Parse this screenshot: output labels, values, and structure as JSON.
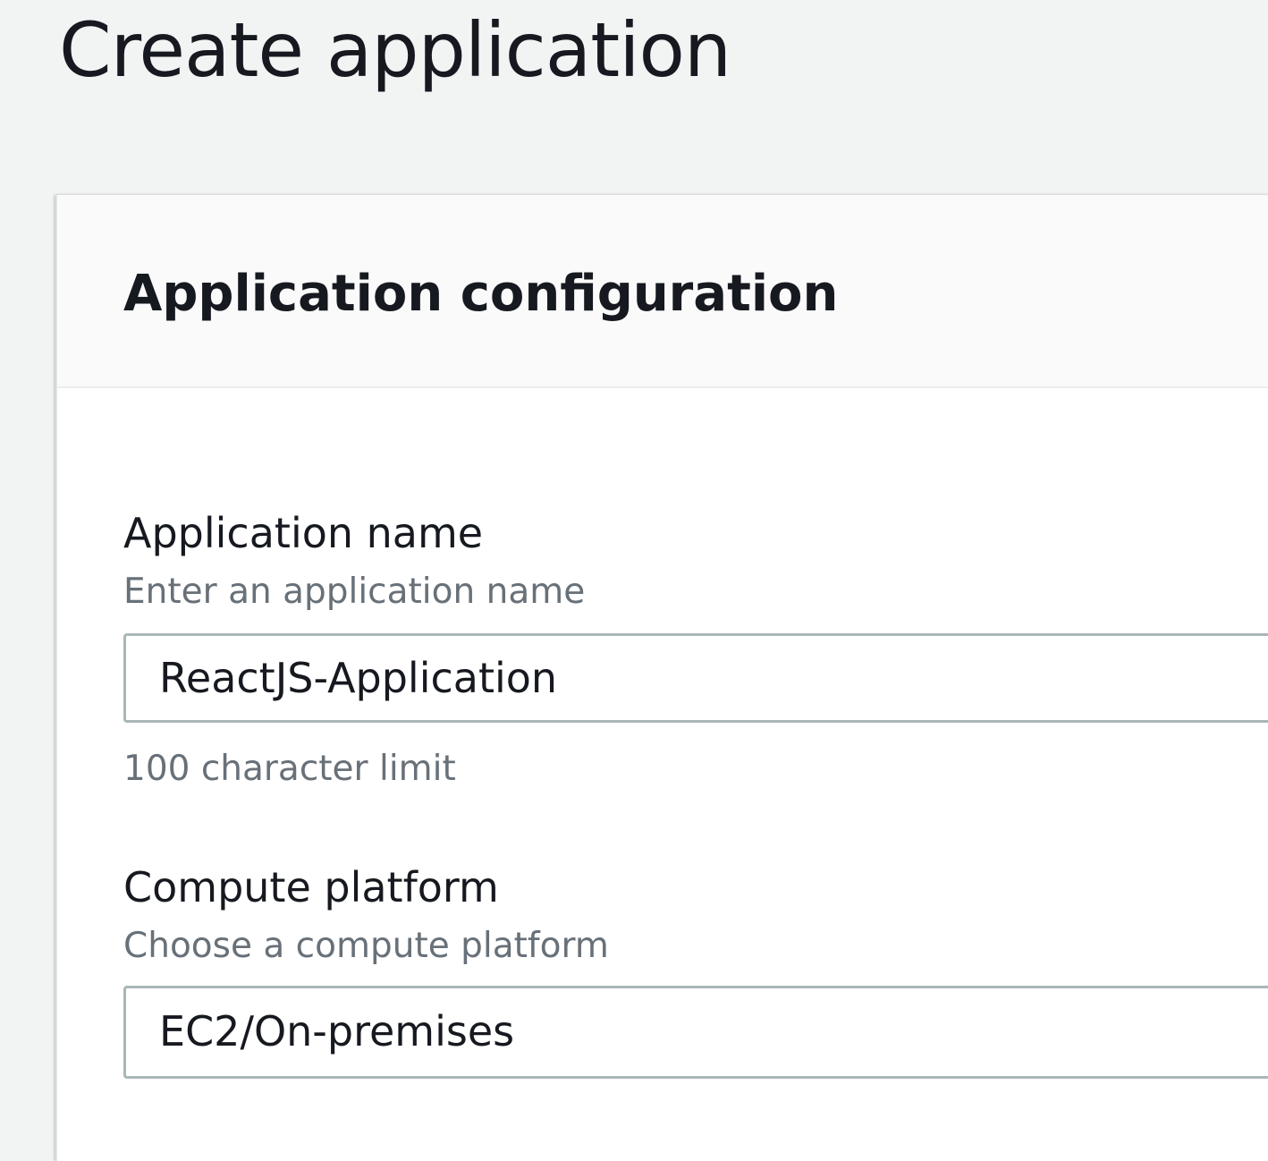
{
  "page": {
    "title": "Create application"
  },
  "app_config": {
    "title": "Application configuration",
    "application_name": {
      "label": "Application name",
      "description": "Enter an application name",
      "value": "ReactJS-Application",
      "constraint": "100 character limit"
    },
    "compute_platform": {
      "label": "Compute platform",
      "description": "Choose a compute platform",
      "selected": "EC2/On-premises"
    }
  }
}
